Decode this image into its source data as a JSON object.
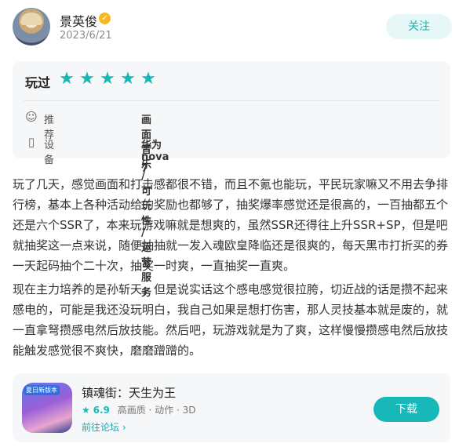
{
  "user": {
    "name": "景英俊",
    "verified_icon": "medal-icon",
    "date": "2023/6/21",
    "follow_label": "关注"
  },
  "rating": {
    "label": "玩过",
    "stars": 5,
    "max_stars": 5,
    "star_color": "#18b8b8",
    "recommend_label": "推荐",
    "recommend_value": "画面音乐 / 可玩性 / 运营服务",
    "device_label": "设备",
    "device_value": "华为 nova 7"
  },
  "review": {
    "p1": "玩了几天，感觉画面和打击感都很不错，而且不氪也能玩，平民玩家嘛又不用去争排行榜，基本上各种活动给的奖励也都够了，抽奖爆率感觉还是很高的，一百抽都五个还是六个SSR了，本来玩游戏嘛就是想爽的，虽然SSR还得往上升SSR+SP，但是吧就抽奖这一点来说，随便抽抽就一发入魂欧皇降临还是很爽的，每天黑市打折买的券一天起码抽个二十次，抽奖一时爽，一直抽奖一直爽。",
    "p2": "现在主力培养的是孙斩天，但是说实话这个感电感觉很拉胯，切近战的话是攒不起来感电的，可能是我还没玩明白，我自己如果是想打伤害，那人灵技基本就是废的，就一直拿弩攒感电然后放技能。然后吧，玩游戏就是为了爽，这样慢慢攒感电然后放技能触发感觉很不爽快，磨磨蹭蹭的。"
  },
  "game": {
    "icon_tag": "夏日新版本",
    "title": "镇魂街：天生为王",
    "score": "6.9",
    "meta": "高画质 · 动作 · 3D",
    "forum_link": "前往论坛",
    "download_label": "下载",
    "accent_color": "#18b8b8"
  }
}
